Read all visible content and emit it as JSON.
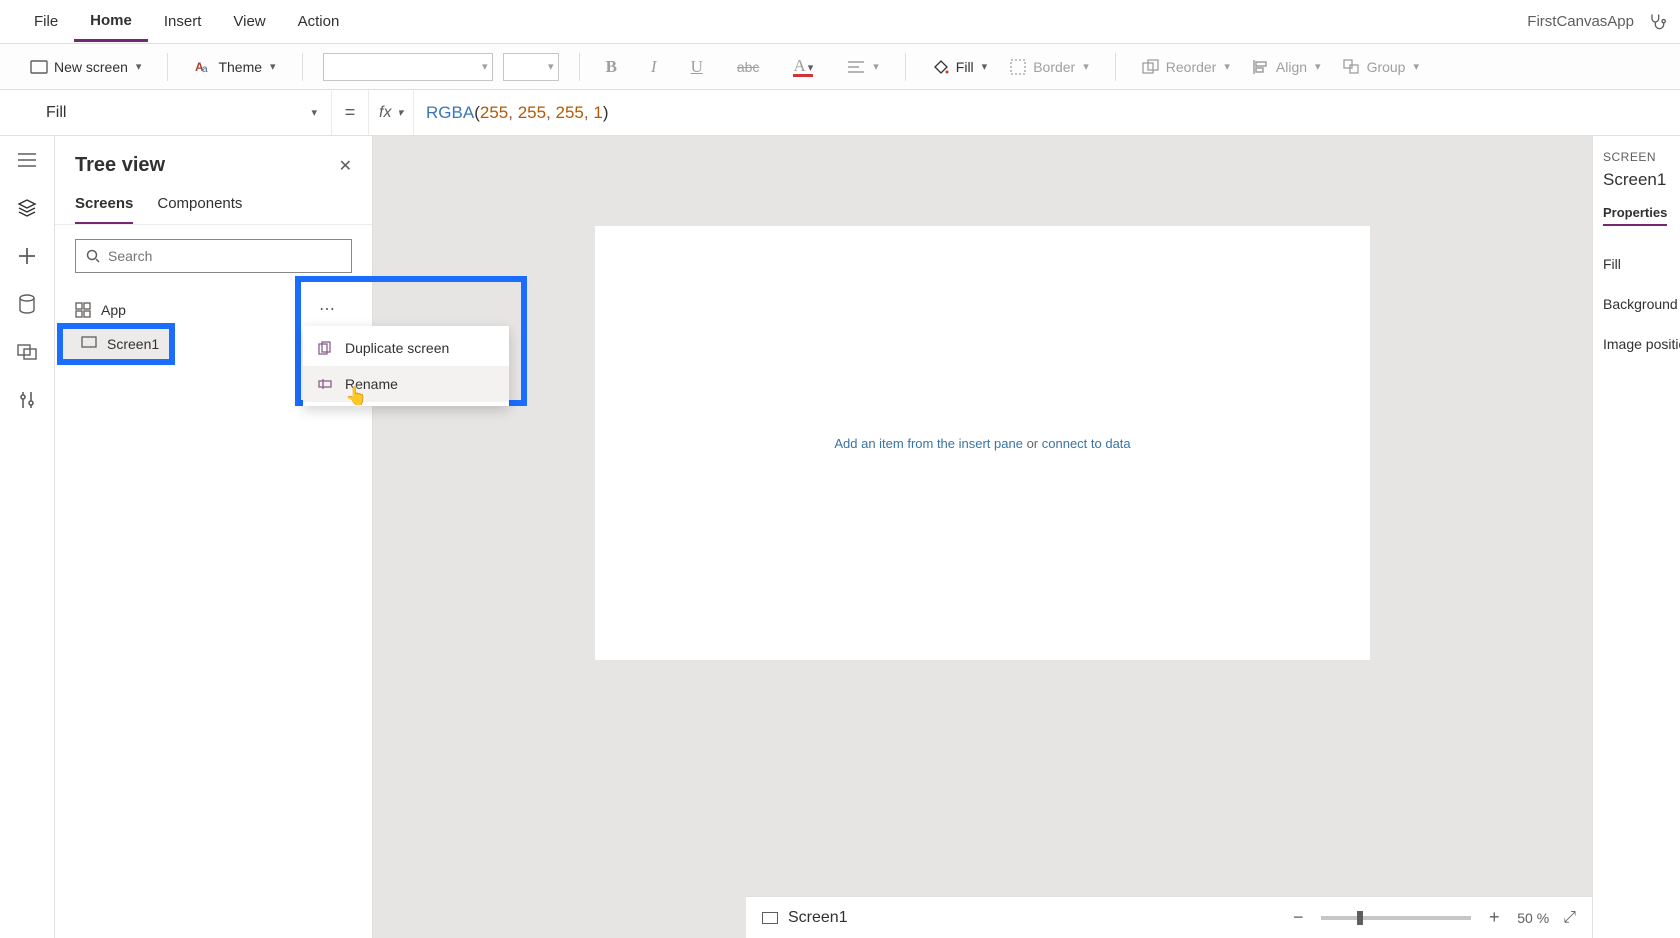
{
  "menubar": {
    "items": [
      "File",
      "Home",
      "Insert",
      "View",
      "Action"
    ],
    "active": "Home",
    "appName": "FirstCanvasApp"
  },
  "ribbon": {
    "newScreen": "New screen",
    "theme": "Theme",
    "fill": "Fill",
    "border": "Border",
    "reorder": "Reorder",
    "align": "Align",
    "group": "Group"
  },
  "formula": {
    "propertyName": "Fill",
    "fn": "RGBA",
    "args": [
      "255",
      "255",
      "255",
      "1"
    ]
  },
  "treeview": {
    "title": "Tree view",
    "tabs": {
      "screens": "Screens",
      "components": "Components"
    },
    "searchPlaceholder": "Search",
    "nodes": {
      "app": "App",
      "screen1": "Screen1"
    }
  },
  "contextMenu": {
    "duplicate": "Duplicate screen",
    "rename": "Rename"
  },
  "canvas": {
    "hintLink1": "Add an item from the insert pane",
    "hintOr": " or ",
    "hintLink2": "connect to data"
  },
  "props": {
    "headerSmall": "SCREEN",
    "name": "Screen1",
    "tab": "Properties",
    "rows": {
      "fill": "Fill",
      "backgroundImage": "Background image",
      "imagePosition": "Image position"
    }
  },
  "status": {
    "screen": "Screen1",
    "zoomPct": "50",
    "pctSymbol": "%"
  }
}
